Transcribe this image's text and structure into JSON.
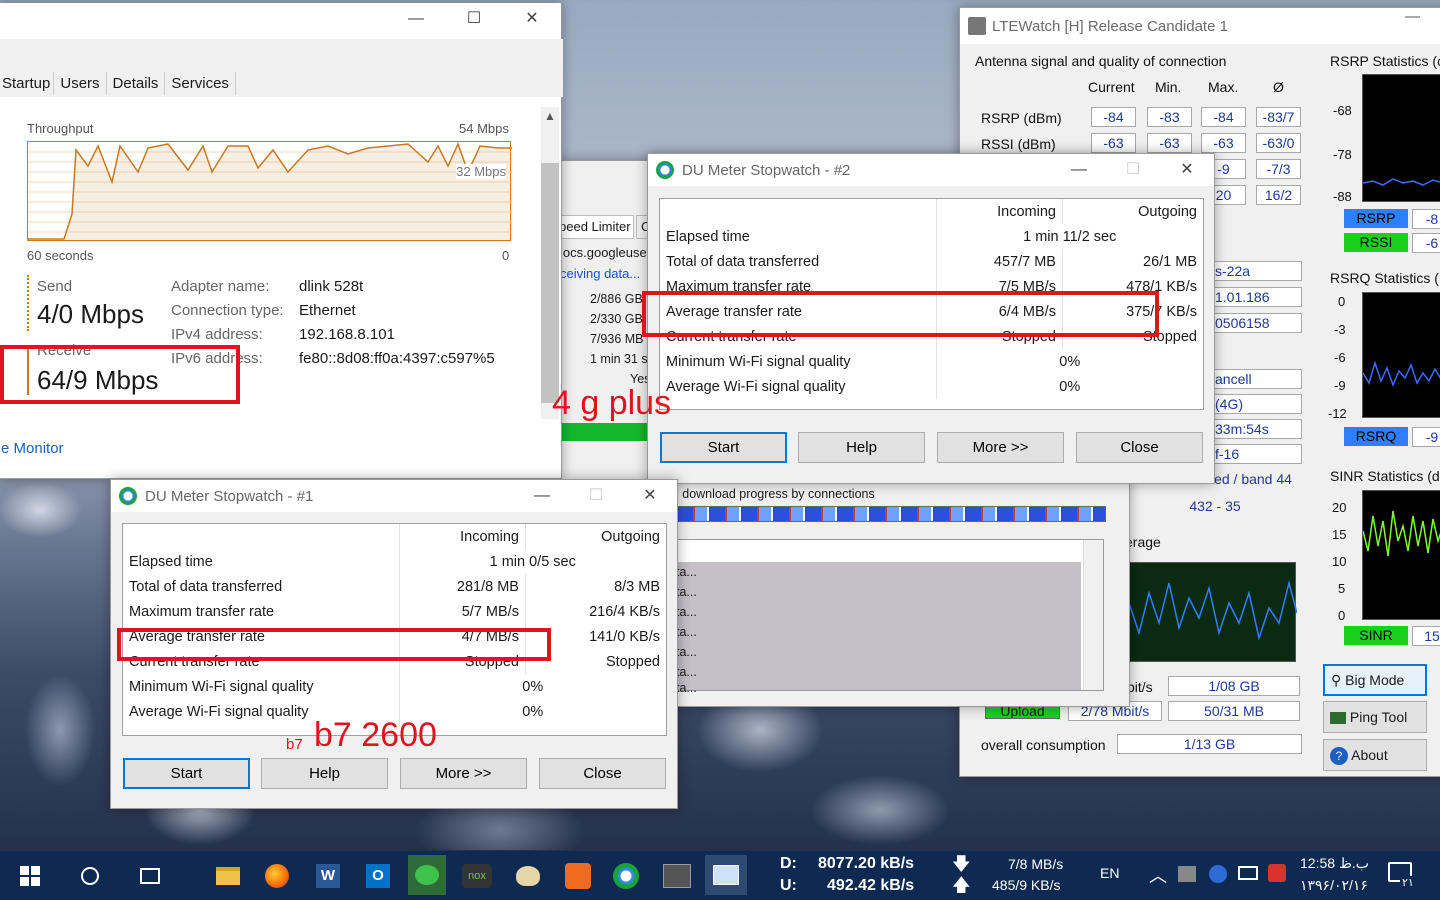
{
  "task_manager": {
    "tabs": [
      "Startup",
      "Users",
      "Details",
      "Services"
    ],
    "throughput_label": "Throughput",
    "max_label": "54 Mbps",
    "mid_label": "32 Mbps",
    "x_left": "60 seconds",
    "x_right": "0",
    "send_label": "Send",
    "send_value": "4/0 Mbps",
    "receive_label": "Receive",
    "receive_value": "64/9 Mbps",
    "adapter_name_label": "Adapter name:",
    "adapter_name": "dlink 528t",
    "connection_type_label": "Connection type:",
    "connection_type": "Ethernet",
    "ipv4_label": "IPv4 address:",
    "ipv4": "192.168.8.101",
    "ipv6_label": "IPv6 address:",
    "ipv6": "fe80::8d08:ff0a:4397:c597%5",
    "resource_monitor_link": "e Monitor",
    "line_color": "#c9781f"
  },
  "du2": {
    "title": "DU Meter Stopwatch - #2",
    "col_incoming": "Incoming",
    "col_outgoing": "Outgoing",
    "elapsed_label": "Elapsed time",
    "elapsed": "1 min 11/2 sec",
    "total_label": "Total of data transferred",
    "total_in": "457/7 MB",
    "total_out": "26/1 MB",
    "max_label": "Maximum transfer rate",
    "max_in": "7/5 MB/s",
    "max_out": "478/1 KB/s",
    "avg_label": "Average transfer rate",
    "avg_in": "6/4 MB/s",
    "avg_out": "375/7 KB/s",
    "cur_label": "Current transfer rate",
    "cur_in": "Stopped",
    "cur_out": "Stopped",
    "minwifi_label": "Minimum Wi-Fi signal quality",
    "minwifi": "0%",
    "avgwifi_label": "Average Wi-Fi signal quality",
    "avgwifi": "0%",
    "btn_start": "Start",
    "btn_help": "Help",
    "btn_more": "More >>",
    "btn_close": "Close"
  },
  "du1": {
    "title": "DU Meter Stopwatch - #1",
    "col_incoming": "Incoming",
    "col_outgoing": "Outgoing",
    "elapsed_label": "Elapsed time",
    "elapsed": "1 min 0/5 sec",
    "total_label": "Total of data transferred",
    "total_in": "281/8 MB",
    "total_out": "8/3 MB",
    "max_label": "Maximum transfer rate",
    "max_in": "5/7 MB/s",
    "max_out": "216/4 KB/s",
    "avg_label": "Average transfer rate",
    "avg_in": "4/7 MB/s",
    "avg_out": "141/0 KB/s",
    "cur_label": "Current transfer rate",
    "cur_in": "Stopped",
    "cur_out": "Stopped",
    "minwifi_label": "Minimum Wi-Fi signal quality",
    "minwifi": "0%",
    "avgwifi_label": "Average Wi-Fi signal quality",
    "avgwifi": "0%",
    "btn_start": "Start",
    "btn_help": "Help",
    "btn_more": "More >>",
    "btn_close": "Close"
  },
  "annotations": {
    "four_g_plus": "4 g plus",
    "b7_small": "b7",
    "b7_big": "b7 2600"
  },
  "download_manager": {
    "tab_speed_limiter": "peed Limiter",
    "tab_next": "C",
    "url": "locs.googleuse",
    "status": "ceiving data...",
    "sizes": [
      "2/886  GB",
      "2/330  GB",
      "7/936  MB",
      "1 min 31 s"
    ],
    "yes": "Yes",
    "progress_label": "l download progress by connections",
    "list_items": [
      "ta...",
      "ta...",
      "ta...",
      "ta...",
      "ta...",
      "ta...",
      "ta..."
    ]
  },
  "ltewatch": {
    "title": "LTEWatch [H]   Release Candidate 1",
    "section_title": "Antenna signal and quality of connection",
    "col_current": "Current",
    "col_min": "Min.",
    "col_max": "Max.",
    "col_avg": "Ø",
    "rows": [
      {
        "label": "RSRP (dBm)",
        "current": "-84",
        "min": "-83",
        "max": "-84",
        "avg": "-83/7"
      },
      {
        "label": "RSSI (dBm)",
        "current": "-63",
        "min": "-63",
        "max": "-63",
        "avg": "-63/0"
      }
    ],
    "partial_max": [
      "-9",
      "20"
    ],
    "partial_avg": [
      "-7/3",
      "16/2"
    ],
    "info": [
      "s-22a",
      "1.01.186",
      "0506158",
      "ancell",
      "(4G)",
      "33m:54s",
      "f-16",
      "LTE-Advanced / band 44",
      "432 - 35"
    ],
    "average_label": "erage",
    "mbit_label": "bit/s",
    "download_total": "1/08 GB",
    "upload_label": "Upload",
    "upload_rate": "2/78 Mbit/s",
    "upload_total": "50/31 MB",
    "overall_label": "overall consumption",
    "overall": "1/13 GB",
    "rsrp_stats_title": "RSRP Statistics (c",
    "rsrp_ticks": [
      "-68",
      "-78",
      "-88"
    ],
    "rsrp_btn": "RSRP",
    "rssi_btn": "RSSI",
    "rsrp_btn_val": "-8",
    "rssi_btn_val": "-6",
    "rsrq_stats_title": "RSRQ Statistics (",
    "rsrq_ticks": [
      "0",
      "-3",
      "-6",
      "-9",
      "-12"
    ],
    "rsrq_btn": "RSRQ",
    "rsrq_btn_val": "-9",
    "sinr_stats_title": "SINR Statistics (d",
    "sinr_ticks": [
      "20",
      "15",
      "10",
      "5",
      "0"
    ],
    "sinr_btn": "SINR",
    "sinr_btn_val": "15",
    "big_mode": "Big Mode",
    "ping_tool": "Ping Tool",
    "about": "About"
  },
  "taskbar": {
    "du_down_label": "D:",
    "du_down": "8077.20 kB/s",
    "du_up_label": "U:",
    "du_up": "492.42 kB/s",
    "nm_down": "7/8 MB/s",
    "nm_up": "485/9 KB/s",
    "lang": "EN",
    "time": "12:58 ب.ظ",
    "date": "۱۳۹۶/۰۲/۱۶",
    "notif_count": "۲۱"
  }
}
